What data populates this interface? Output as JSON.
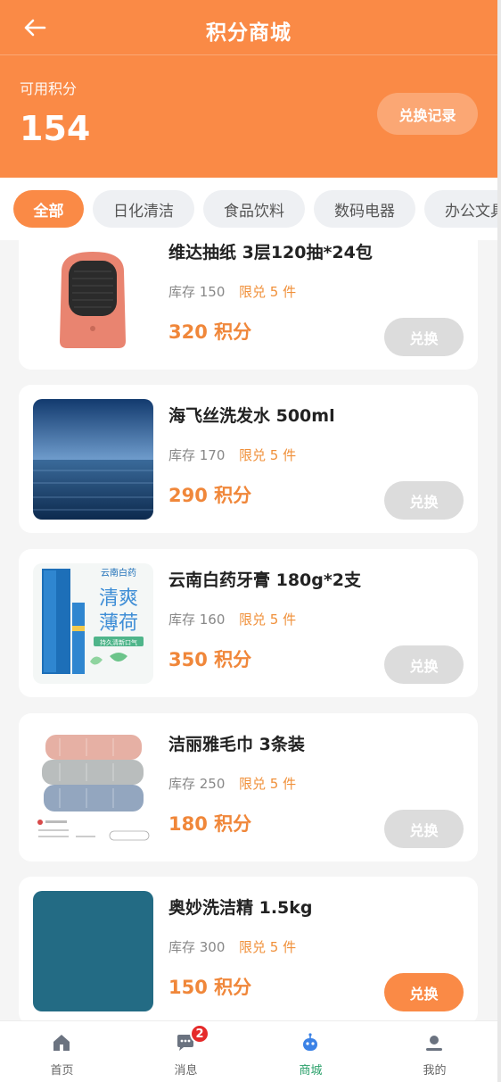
{
  "header": {
    "back_icon": "arrow-left-icon",
    "title": "积分商城",
    "points_label": "可用积分",
    "points_value": "154",
    "record_button": "兑换记录"
  },
  "tabs": [
    {
      "label": "全部",
      "active": true
    },
    {
      "label": "日化清洁",
      "active": false
    },
    {
      "label": "食品饮料",
      "active": false
    },
    {
      "label": "数码电器",
      "active": false
    },
    {
      "label": "办公文具",
      "active": false
    }
  ],
  "products": [
    {
      "name": "维达抽纸 3层120抽*24包",
      "stock": "库存 150",
      "limit": "限兑 5 件",
      "price": "320 积分",
      "button": "兑换",
      "enabled": false,
      "image": "heater-image"
    },
    {
      "name": "海飞丝洗发水 500ml",
      "stock": "库存 170",
      "limit": "限兑 5 件",
      "price": "290 积分",
      "button": "兑换",
      "enabled": false,
      "image": "ocean-image"
    },
    {
      "name": "云南白药牙膏 180g*2支",
      "stock": "库存 160",
      "limit": "限兑 5 件",
      "price": "350 积分",
      "button": "兑换",
      "enabled": false,
      "image": "toothpaste-image",
      "image_text": {
        "brand": "云南白药",
        "line1": "清爽",
        "line2": "薄荷",
        "tag": "持久清新口气"
      }
    },
    {
      "name": "洁丽雅毛巾 3条装",
      "stock": "库存 250",
      "limit": "限兑 5 件",
      "price": "180 积分",
      "button": "兑换",
      "enabled": false,
      "image": "towels-image"
    },
    {
      "name": "奥妙洗洁精 1.5kg",
      "stock": "库存 300",
      "limit": "限兑 5 件",
      "price": "150 积分",
      "button": "兑换",
      "enabled": true,
      "image": "teal-image"
    }
  ],
  "navbar": [
    {
      "label": "首页",
      "icon": "home-icon",
      "active": false
    },
    {
      "label": "消息",
      "icon": "message-icon",
      "active": false,
      "badge": "2"
    },
    {
      "label": "商城",
      "icon": "robot-icon",
      "active": true
    },
    {
      "label": "我的",
      "icon": "user-icon",
      "active": false
    }
  ],
  "colors": {
    "accent": "#fa8a46",
    "price": "#f0873a",
    "active_nav": "#2aa06a",
    "badge": "#e52a2a"
  }
}
